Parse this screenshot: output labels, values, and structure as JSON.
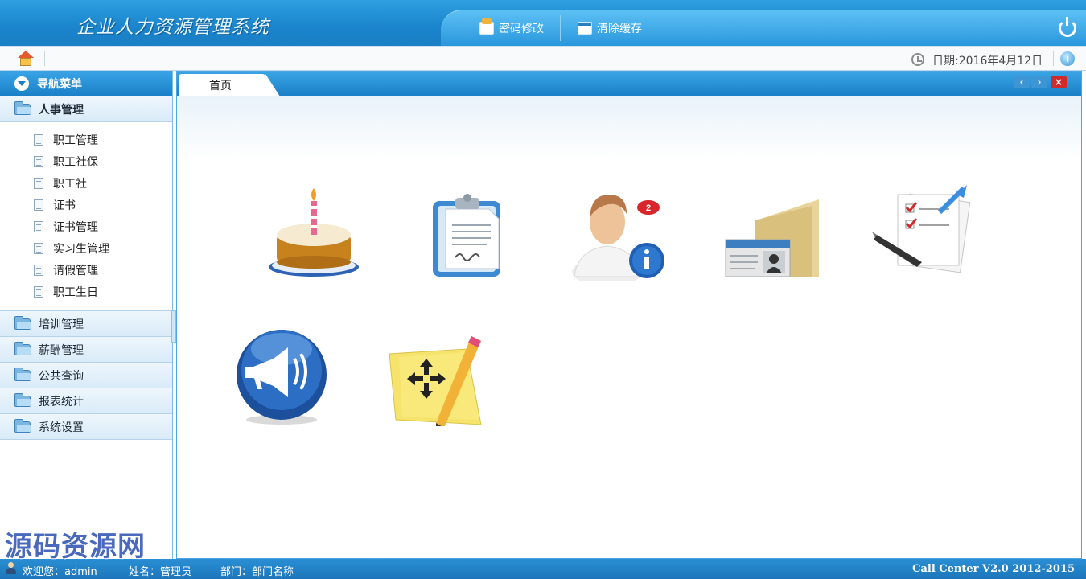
{
  "header": {
    "app_title": "企业人力资源管理系统",
    "tabs": [
      {
        "label": "密码修改",
        "icon": "password-icon"
      },
      {
        "label": "清除缓存",
        "icon": "window-icon"
      }
    ],
    "logout_icon": "power-icon"
  },
  "toolbar": {
    "date_text": "日期:2016年4月12日",
    "home_icon": "home-icon",
    "info_icon": "info-icon"
  },
  "sidebar": {
    "title": "导航菜单",
    "open_group": {
      "label": "人事管理",
      "items": [
        "职工管理",
        "职工社保",
        "职工社",
        "证书",
        "证书管理",
        "实习生管理",
        "请假管理",
        "职工生日"
      ]
    },
    "groups": [
      "培训管理",
      "薪酬管理",
      "公共查询",
      "报表统计",
      "系统设置"
    ]
  },
  "main": {
    "tabs": [
      "首页"
    ],
    "tiles": [
      {
        "icon": "birthday-cake-icon"
      },
      {
        "icon": "clipboard-document-icon"
      },
      {
        "icon": "user-info-icon",
        "badge": "2"
      },
      {
        "icon": "folder-id-card-icon"
      },
      {
        "icon": "checklist-edit-icon"
      },
      {
        "icon": "megaphone-icon"
      },
      {
        "icon": "move-note-icon"
      }
    ]
  },
  "footer": {
    "welcome": "欢迎您：admin",
    "name": "姓名：管理员",
    "dept": "部门：部门名称",
    "copyright": "Call Center V2.0 2012-2015"
  },
  "watermark": "源码资源网",
  "colors": {
    "primary": "#1a7fc7",
    "accent": "#3aa4e6",
    "footer": "#1d76ba"
  }
}
